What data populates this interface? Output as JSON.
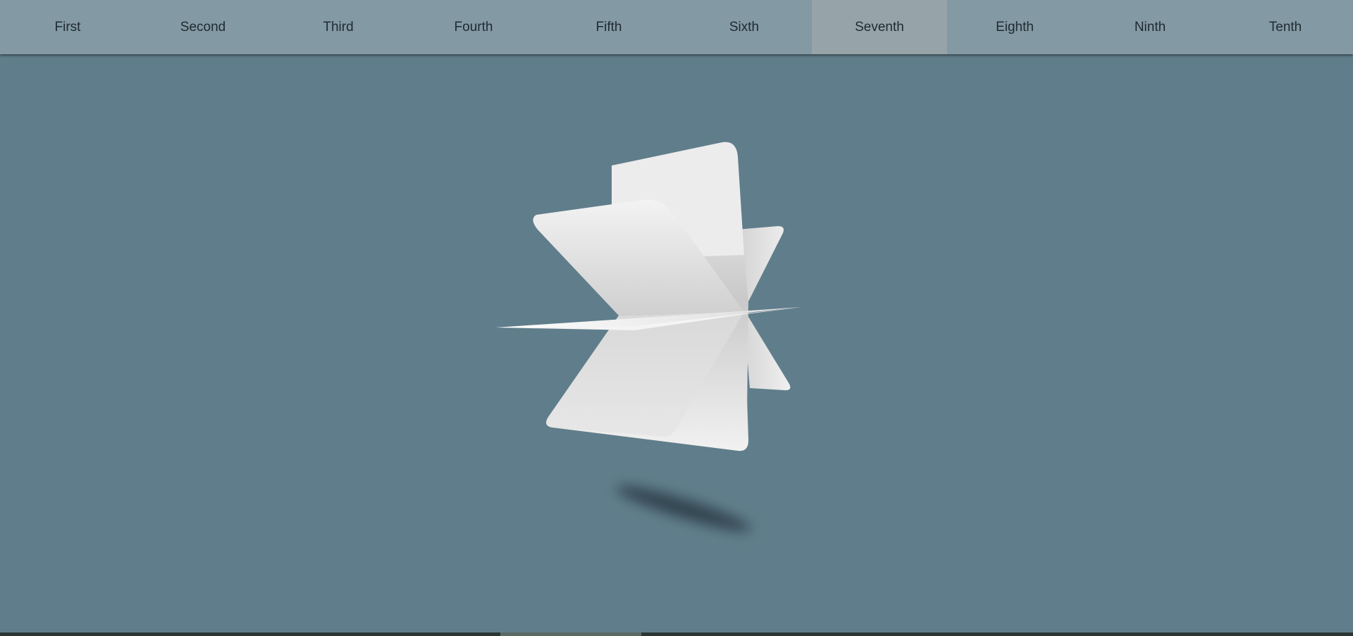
{
  "nav": {
    "items": [
      {
        "label": "First"
      },
      {
        "label": "Second"
      },
      {
        "label": "Third"
      },
      {
        "label": "Fourth"
      },
      {
        "label": "Fifth"
      },
      {
        "label": "Sixth"
      },
      {
        "label": "Seventh"
      },
      {
        "label": "Eighth"
      },
      {
        "label": "Ninth"
      },
      {
        "label": "Tenth"
      }
    ],
    "active_index": 6
  },
  "colors": {
    "background": "#607d8b",
    "nav_background": "#8399a4",
    "nav_active": "#96a4a9",
    "card": "#e6e6e6"
  }
}
